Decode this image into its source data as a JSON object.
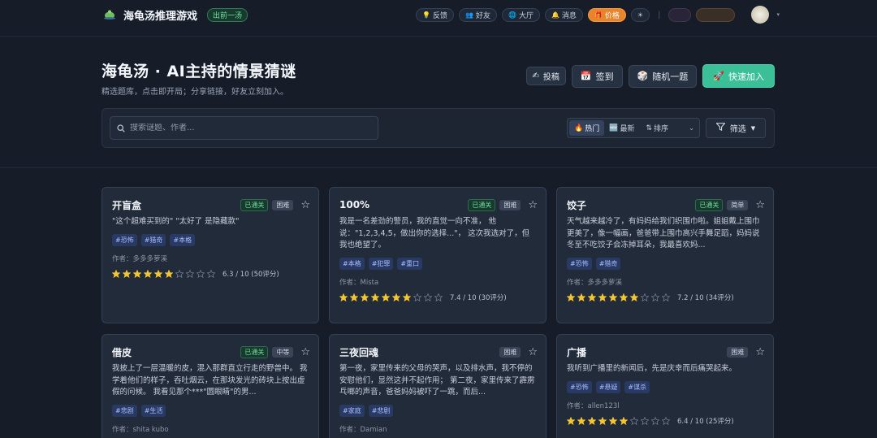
{
  "header": {
    "brand": "海龟汤推理游戏",
    "brand_badge": "出前一汤",
    "nav": [
      {
        "label": "反馈",
        "icon": "bulb-icon"
      },
      {
        "label": "好友",
        "icon": "friends-icon"
      },
      {
        "label": "大厅",
        "icon": "globe-icon"
      },
      {
        "label": "消息",
        "icon": "bell-icon"
      },
      {
        "label": "价格",
        "icon": "gift-icon"
      }
    ],
    "colors": {
      "price": "#e8852c",
      "accent": "#3bbf97"
    }
  },
  "hero": {
    "title": "海龟汤 · AI主持的情景猜谜",
    "subtitle": "精选题库，点击即开局；分享链接，好友立刻加入。",
    "buttons": {
      "submit": "投稿",
      "checkin": "签到",
      "random": "随机一题",
      "quick_join": "快速加入"
    }
  },
  "filters": {
    "search_placeholder": "搜索谜题、作者...",
    "hot": "热门",
    "latest": "最新",
    "sort": "排序",
    "filter": "筛选"
  },
  "cards": [
    {
      "title": "开盲盒",
      "passed": "已通关",
      "difficulty": "困难",
      "desc": "\"这个超难买到的\" \"太好了 是隐藏款\"",
      "tags": [
        "#恐怖",
        "#猎奇",
        "#本格"
      ],
      "author": "作者：多多多萝溪",
      "rating": 6.3,
      "rating_text": "6.3 / 10 (50评分)"
    },
    {
      "title": "100%",
      "passed": "已通关",
      "difficulty": "困难",
      "desc": "我是一名差劲的警员，我的直觉一向不准， 他说：\"1,2,3,4,5，做出你的选择...\"， 这次我选对了，但我也绝望了。",
      "tags": [
        "#本格",
        "#犯罪",
        "#重口"
      ],
      "author": "作者：Mista",
      "rating": 7.4,
      "rating_text": "7.4 / 10 (30评分)"
    },
    {
      "title": "饺子",
      "passed": "已通关",
      "difficulty": "简单",
      "desc": "天气越来越冷了，有妈妈给我们织围巾啦。姐姐戴上围巾更美了，像一幅画，爸爸带上围巾高兴手舞足蹈，妈妈说冬至不吃饺子会冻掉耳朵，我最喜欢妈...",
      "tags": [
        "#恐怖",
        "#猎奇"
      ],
      "author": "作者：多多多萝溪",
      "rating": 7.2,
      "rating_text": "7.2 / 10 (34评分)"
    },
    {
      "title": "借皮",
      "passed": "已通关",
      "difficulty": "中等",
      "desc": "我披上了一层温暖的皮，混入那群直立行走的野兽中。 我学着他们的样子，吞吐烟云，在那块发光的砖块上按出虚假的问候。 我看见那个***\"圆眼睛\"的男...",
      "tags": [
        "#悲剧",
        "#生活"
      ],
      "author": "作者：shita kubo",
      "rating": null,
      "rating_text": ""
    },
    {
      "title": "三夜回魂",
      "passed": "",
      "difficulty": "困难",
      "desc": "第一夜，家里传来的父母的哭声，以及排水声，我不停的安慰他们，显然这并不起作用； 第二夜，家里传来了霹雳乓啷的声音，爸爸妈妈被吓了一跳，而后...",
      "tags": [
        "#家庭",
        "#悲剧"
      ],
      "author": "作者：Damian",
      "rating": null,
      "rating_text": ""
    },
    {
      "title": "广播",
      "passed": "",
      "difficulty": "困难",
      "desc": "我听到广播里的新闻后，先是庆幸而后痛哭起来。",
      "tags": [
        "#恐怖",
        "#悬疑",
        "#谋杀"
      ],
      "author": "作者：allen123l",
      "rating": 6.4,
      "rating_text": "6.4 / 10 (25评分)"
    }
  ]
}
